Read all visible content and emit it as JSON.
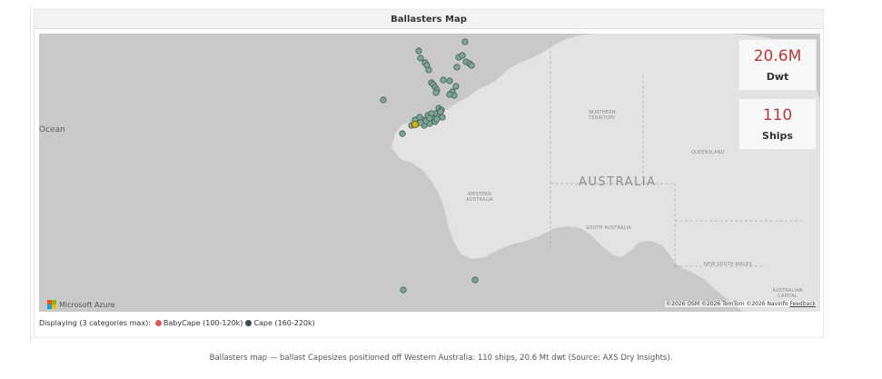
{
  "panel": {
    "title": "Ballasters Map"
  },
  "map": {
    "ocean_label": "Ocean",
    "regions": {
      "northern_territory": "NORTHERN\nTERRITORY",
      "queensland": "QUEENSLAND",
      "western_australia": "WESTERN\nAUSTRALIA",
      "south_australia": "SOUTH AUSTRALIA",
      "new_south_wales": "NEW SOUTH WALES",
      "act": "AUSTRALIAN\nCAPITAL"
    },
    "country_label": "AUSTRALIA",
    "provider_logo_text": "Microsoft Azure",
    "attribution": "©2026 OSM  ©2026 TomTom  ©2026 Navinfo",
    "feedback_link": "Feedback",
    "colors": {
      "water": "#c9c9c9",
      "land": "#e3e3e3",
      "marker_fill": "#7fa594",
      "marker_stroke": "#3f5f52",
      "highlight_fill": "#c9b21a",
      "highlight_stroke": "#6b5a06"
    }
  },
  "kpis": [
    {
      "value": "20.6M",
      "label": "Dwt"
    },
    {
      "value": "110",
      "label": "Ships"
    }
  ],
  "legend": {
    "title": "Displaying (3 categories max):",
    "items": [
      {
        "label": "BabyCape (100-120k)",
        "color": "#e05a5a"
      },
      {
        "label": "Cape (160-220k)",
        "color": "#404850"
      }
    ]
  },
  "caption": "Ballasters map — ballast Capesizes positioned off Western Australia: 110 ships, 20.6 Mt dwt (Source: AXS Dry Insights)."
}
